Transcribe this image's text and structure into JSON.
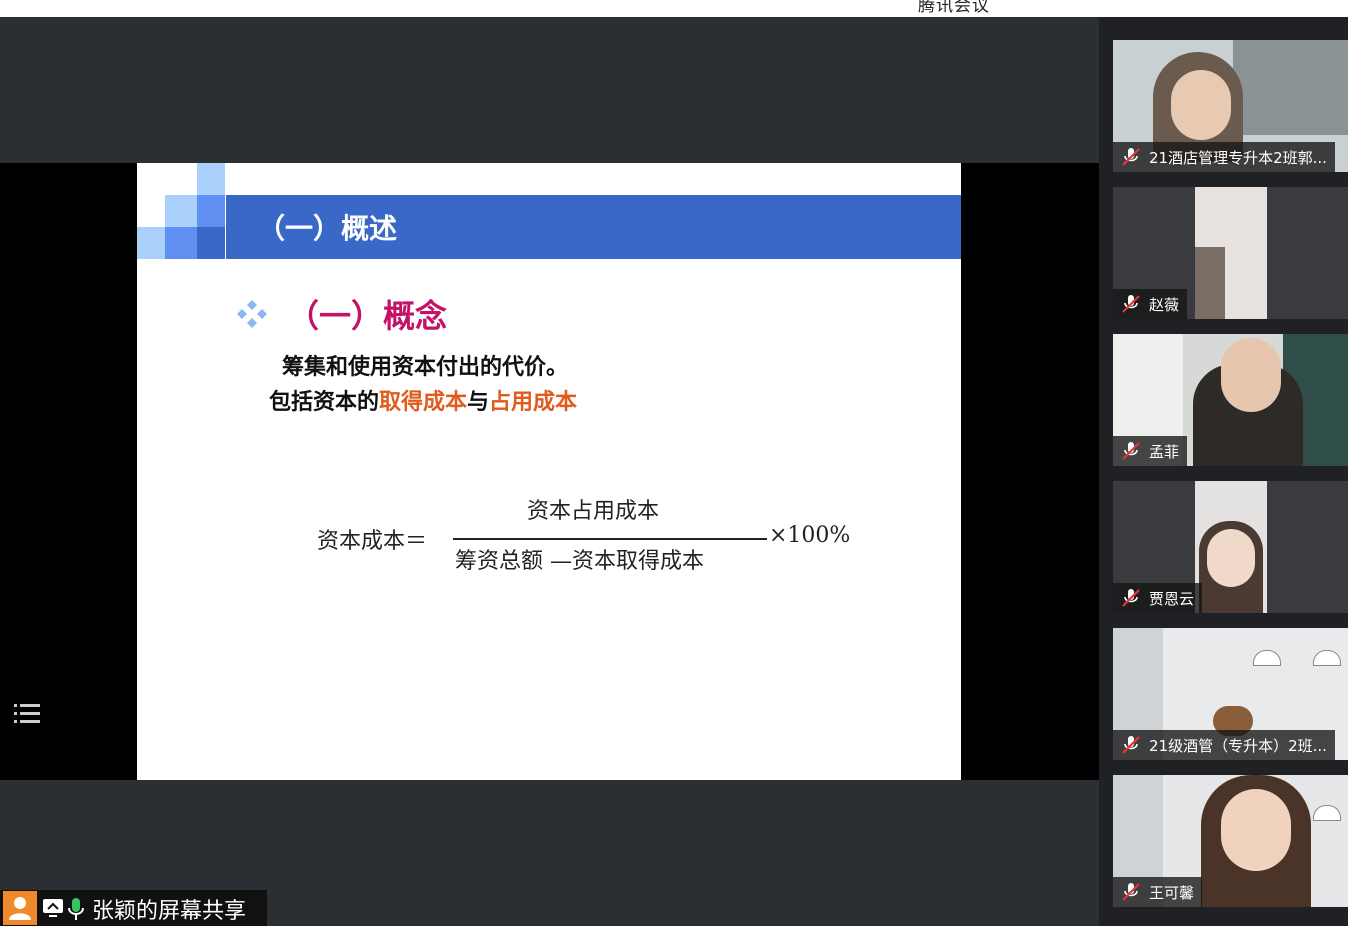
{
  "app": {
    "title": "腾讯会议"
  },
  "slide": {
    "title": "（一）概述",
    "subheading": "（一）概念",
    "line1": "筹集和使用资本付出的代价。",
    "line2_prefix": "包括资本的",
    "line2_highlight1": "取得成本",
    "line2_mid": "与",
    "line2_highlight2": "占用成本",
    "formula": {
      "lhs": "资本成本＝",
      "numerator": "资本占用成本",
      "denominator": "筹资总额 —资本取得成本",
      "multiplier": "×100%"
    }
  },
  "share": {
    "label": "张颖的屏幕共享"
  },
  "participants": [
    {
      "name": "21酒店管理专升本2班郭..."
    },
    {
      "name": "赵薇"
    },
    {
      "name": "孟菲"
    },
    {
      "name": "贾恩云"
    },
    {
      "name": "21级酒管（专升本）2班..."
    },
    {
      "name": "王可馨"
    }
  ],
  "colors": {
    "accent_blue": "#3a68c8",
    "subheading": "#c41268",
    "highlight": "#e25a1c",
    "share_user": "#f0892a"
  }
}
